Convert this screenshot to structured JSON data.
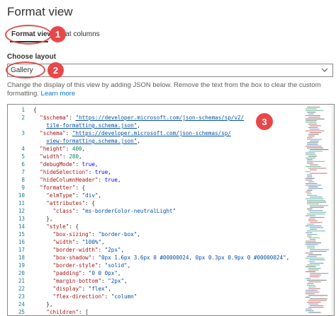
{
  "panel": {
    "title": "Format view"
  },
  "tabs": [
    {
      "label": "Format view",
      "selected": true
    },
    {
      "label": "mat columns",
      "selected": false
    }
  ],
  "layout": {
    "label": "Choose layout",
    "selected": "Gallery"
  },
  "help": {
    "text": "Change the display of this view by adding JSON below. Remove the text from the box to clear the custom formatting. ",
    "link": "Learn more"
  },
  "callouts": [
    "1",
    "2",
    "3"
  ],
  "colors": {
    "callout": "#e8474a",
    "accent": "#0078d4"
  },
  "editor": {
    "lines": [
      {
        "num": "1",
        "tokens": [
          {
            "t": "{",
            "c": ""
          }
        ]
      },
      {
        "num": "2",
        "tokens": [
          {
            "t": "  ",
            "c": ""
          },
          {
            "t": "\"$schema\"",
            "c": "k"
          },
          {
            "t": ": ",
            "c": ""
          },
          {
            "t": "\"https://developer.microsoft.com/json-schemas/sp/v2/",
            "c": "u"
          }
        ]
      },
      {
        "num": "",
        "tokens": [
          {
            "t": "    ",
            "c": ""
          },
          {
            "t": "tile-formatting.schema.json\"",
            "c": "u"
          },
          {
            "t": ",",
            "c": ""
          }
        ]
      },
      {
        "num": "3",
        "tokens": [
          {
            "t": "  ",
            "c": ""
          },
          {
            "t": "\"schema\"",
            "c": "k"
          },
          {
            "t": ": ",
            "c": ""
          },
          {
            "t": "\"https://developer.microsoft.com/json-schemas/sp/",
            "c": "u"
          }
        ]
      },
      {
        "num": "",
        "tokens": [
          {
            "t": "    ",
            "c": ""
          },
          {
            "t": "view-formatting.schema.json\"",
            "c": "u"
          },
          {
            "t": ",",
            "c": ""
          }
        ]
      },
      {
        "num": "4",
        "tokens": [
          {
            "t": "  ",
            "c": ""
          },
          {
            "t": "\"height\"",
            "c": "k"
          },
          {
            "t": ": ",
            "c": ""
          },
          {
            "t": "400",
            "c": "n"
          },
          {
            "t": ",",
            "c": ""
          }
        ]
      },
      {
        "num": "5",
        "tokens": [
          {
            "t": "  ",
            "c": ""
          },
          {
            "t": "\"width\"",
            "c": "k"
          },
          {
            "t": ": ",
            "c": ""
          },
          {
            "t": "280",
            "c": "n"
          },
          {
            "t": ",",
            "c": ""
          }
        ]
      },
      {
        "num": "6",
        "tokens": [
          {
            "t": "  ",
            "c": ""
          },
          {
            "t": "\"debugMode\"",
            "c": "k"
          },
          {
            "t": ": ",
            "c": ""
          },
          {
            "t": "true",
            "c": "b"
          },
          {
            "t": ",",
            "c": ""
          }
        ]
      },
      {
        "num": "7",
        "tokens": [
          {
            "t": "  ",
            "c": ""
          },
          {
            "t": "\"hideSelection\"",
            "c": "k"
          },
          {
            "t": ": ",
            "c": ""
          },
          {
            "t": "true",
            "c": "b"
          },
          {
            "t": ",",
            "c": ""
          }
        ]
      },
      {
        "num": "8",
        "tokens": [
          {
            "t": "  ",
            "c": ""
          },
          {
            "t": "\"hideColumnHeader\"",
            "c": "k"
          },
          {
            "t": ": ",
            "c": ""
          },
          {
            "t": "true",
            "c": "b"
          },
          {
            "t": ",",
            "c": ""
          }
        ]
      },
      {
        "num": "9",
        "tokens": [
          {
            "t": "  ",
            "c": ""
          },
          {
            "t": "\"formatter\"",
            "c": "k"
          },
          {
            "t": ": {",
            "c": ""
          }
        ]
      },
      {
        "num": "10",
        "tokens": [
          {
            "t": "    ",
            "c": ""
          },
          {
            "t": "\"elmType\"",
            "c": "k"
          },
          {
            "t": ": ",
            "c": ""
          },
          {
            "t": "\"div\"",
            "c": "s"
          },
          {
            "t": ",",
            "c": ""
          }
        ]
      },
      {
        "num": "11",
        "tokens": [
          {
            "t": "    ",
            "c": ""
          },
          {
            "t": "\"attributes\"",
            "c": "k"
          },
          {
            "t": ": {",
            "c": ""
          }
        ]
      },
      {
        "num": "12",
        "tokens": [
          {
            "t": "      ",
            "c": ""
          },
          {
            "t": "\"class\"",
            "c": "k"
          },
          {
            "t": ": ",
            "c": ""
          },
          {
            "t": "\"ms-borderColor-neutralLight\"",
            "c": "s"
          }
        ]
      },
      {
        "num": "13",
        "tokens": [
          {
            "t": "    },",
            "c": ""
          }
        ]
      },
      {
        "num": "14",
        "tokens": [
          {
            "t": "    ",
            "c": ""
          },
          {
            "t": "\"style\"",
            "c": "k"
          },
          {
            "t": ": {",
            "c": ""
          }
        ]
      },
      {
        "num": "15",
        "tokens": [
          {
            "t": "      ",
            "c": ""
          },
          {
            "t": "\"box-sizing\"",
            "c": "k"
          },
          {
            "t": ": ",
            "c": ""
          },
          {
            "t": "\"border-box\"",
            "c": "s"
          },
          {
            "t": ",",
            "c": ""
          }
        ]
      },
      {
        "num": "16",
        "tokens": [
          {
            "t": "      ",
            "c": ""
          },
          {
            "t": "\"width\"",
            "c": "k"
          },
          {
            "t": ": ",
            "c": ""
          },
          {
            "t": "\"100%\"",
            "c": "s"
          },
          {
            "t": ",",
            "c": ""
          }
        ]
      },
      {
        "num": "17",
        "tokens": [
          {
            "t": "      ",
            "c": ""
          },
          {
            "t": "\"border-width\"",
            "c": "k"
          },
          {
            "t": ": ",
            "c": ""
          },
          {
            "t": "\"2px\"",
            "c": "s"
          },
          {
            "t": ",",
            "c": ""
          }
        ]
      },
      {
        "num": "18",
        "tokens": [
          {
            "t": "      ",
            "c": ""
          },
          {
            "t": "\"box-shadow\"",
            "c": "k"
          },
          {
            "t": ": ",
            "c": ""
          },
          {
            "t": "\"0px 1.6px 3.6px 0 #00000024, 0px 0.3px 0.9px 0 #00000024\"",
            "c": "s"
          },
          {
            "t": ",",
            "c": ""
          }
        ]
      },
      {
        "num": "19",
        "tokens": [
          {
            "t": "      ",
            "c": ""
          },
          {
            "t": "\"border-style\"",
            "c": "k"
          },
          {
            "t": ": ",
            "c": ""
          },
          {
            "t": "\"solid\"",
            "c": "s"
          },
          {
            "t": ",",
            "c": ""
          }
        ]
      },
      {
        "num": "20",
        "tokens": [
          {
            "t": "      ",
            "c": ""
          },
          {
            "t": "\"padding\"",
            "c": "k"
          },
          {
            "t": ": ",
            "c": ""
          },
          {
            "t": "\"0 0 0px\"",
            "c": "s"
          },
          {
            "t": ",",
            "c": ""
          }
        ]
      },
      {
        "num": "21",
        "tokens": [
          {
            "t": "      ",
            "c": ""
          },
          {
            "t": "\"margin-bottom\"",
            "c": "k"
          },
          {
            "t": ": ",
            "c": ""
          },
          {
            "t": "\"2px\"",
            "c": "s"
          },
          {
            "t": ",",
            "c": ""
          }
        ]
      },
      {
        "num": "22",
        "tokens": [
          {
            "t": "      ",
            "c": ""
          },
          {
            "t": "\"display\"",
            "c": "k"
          },
          {
            "t": ": ",
            "c": ""
          },
          {
            "t": "\"flex\"",
            "c": "s"
          },
          {
            "t": ",",
            "c": ""
          }
        ]
      },
      {
        "num": "23",
        "tokens": [
          {
            "t": "      ",
            "c": ""
          },
          {
            "t": "\"flex-direction\"",
            "c": "k"
          },
          {
            "t": ": ",
            "c": ""
          },
          {
            "t": "\"column\"",
            "c": "s"
          }
        ]
      },
      {
        "num": "24",
        "tokens": [
          {
            "t": "    },",
            "c": ""
          }
        ]
      },
      {
        "num": "25",
        "tokens": [
          {
            "t": "    ",
            "c": ""
          },
          {
            "t": "\"children\"",
            "c": "k"
          },
          {
            "t": ": [",
            "c": ""
          }
        ]
      },
      {
        "num": "26",
        "tokens": [
          {
            "t": "      {",
            "c": ""
          }
        ]
      }
    ]
  }
}
